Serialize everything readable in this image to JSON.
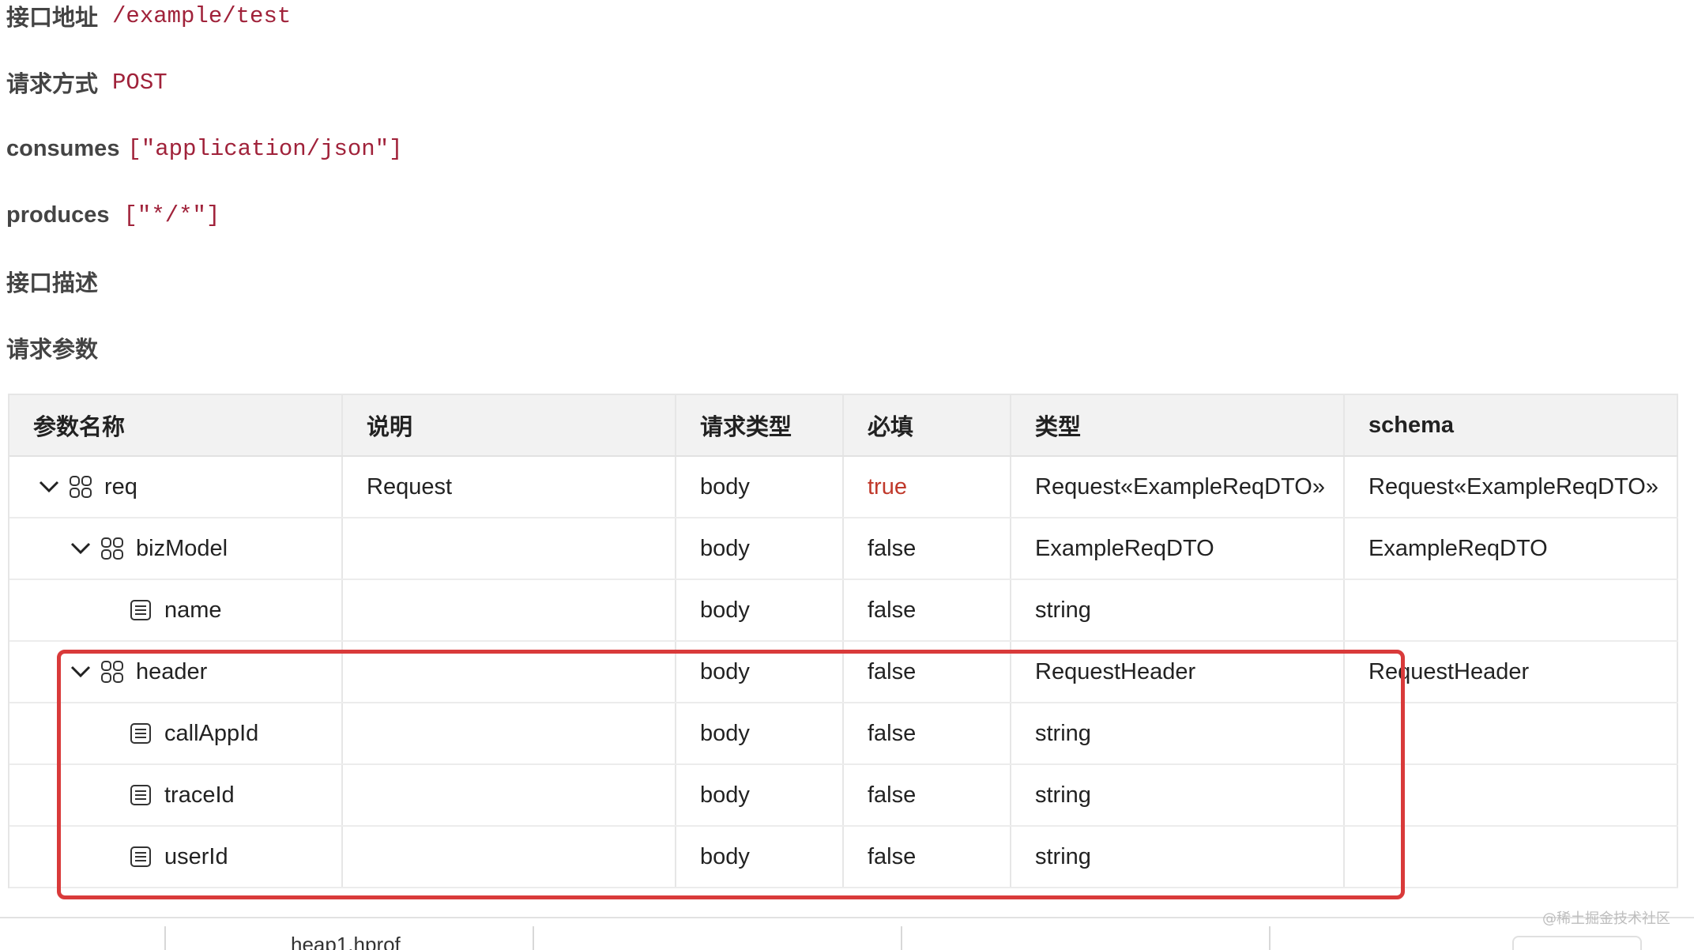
{
  "api": {
    "address_label": "接口地址",
    "address_value": "/example/test",
    "method_label": "请求方式",
    "method_value": "POST",
    "consumes_label": "consumes",
    "consumes_value": "[\"application/json\"]",
    "produces_label": "produces",
    "produces_value": "[\"*/*\"]",
    "description_label": "接口描述",
    "params_label": "请求参数"
  },
  "table": {
    "headers": [
      "参数名称",
      "说明",
      "请求类型",
      "必填",
      "类型",
      "schema"
    ],
    "rows": [
      {
        "name": "req",
        "desc": "Request",
        "in": "body",
        "required": "true",
        "type": "Request«ExampleReqDTO»",
        "schema": "Request«ExampleReqDTO»",
        "icon": "object-icon",
        "expander": "chevron-down-icon"
      },
      {
        "name": "bizModel",
        "desc": "",
        "in": "body",
        "required": "false",
        "type": "ExampleReqDTO",
        "schema": "ExampleReqDTO",
        "icon": "object-icon",
        "expander": "chevron-down-icon"
      },
      {
        "name": "name",
        "desc": "",
        "in": "body",
        "required": "false",
        "type": "string",
        "schema": "",
        "icon": "field-icon"
      },
      {
        "name": "header",
        "desc": "",
        "in": "body",
        "required": "false",
        "type": "RequestHeader",
        "schema": "RequestHeader",
        "icon": "object-icon",
        "expander": "chevron-down-icon"
      },
      {
        "name": "callAppId",
        "desc": "",
        "in": "body",
        "required": "false",
        "type": "string",
        "schema": "",
        "icon": "field-icon"
      },
      {
        "name": "traceId",
        "desc": "",
        "in": "body",
        "required": "false",
        "type": "string",
        "schema": "",
        "icon": "field-icon"
      },
      {
        "name": "userId",
        "desc": "",
        "in": "body",
        "required": "false",
        "type": "string",
        "schema": "",
        "icon": "field-icon"
      }
    ]
  },
  "bottom": {
    "file_name": "heap1.hprof"
  },
  "watermark": "@稀土掘金技术社区",
  "colors": {
    "accent_red": "#d93a3a",
    "code_red": "#a0223a",
    "required_true": "#c0392b"
  }
}
